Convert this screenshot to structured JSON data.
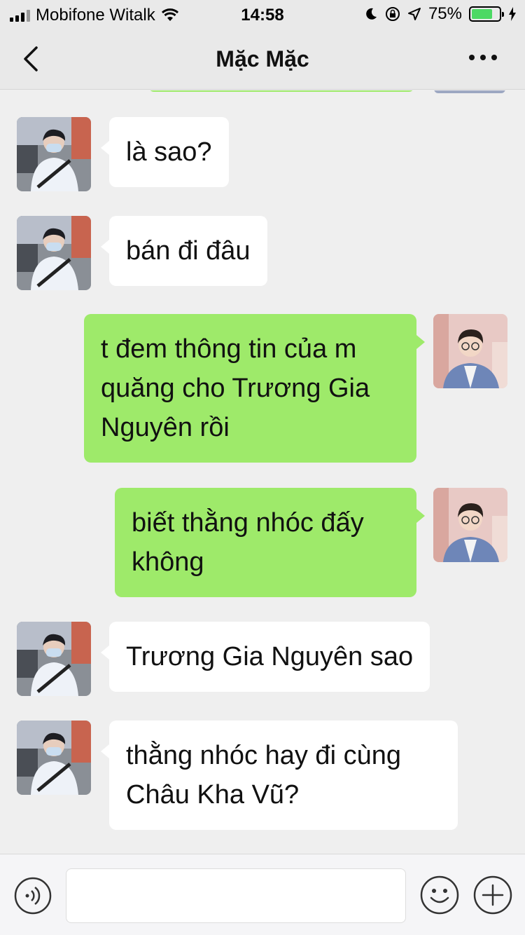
{
  "status_bar": {
    "carrier": "Mobifone Witalk",
    "time": "14:58",
    "battery_percent": "75%",
    "battery_level": 0.75,
    "signal_bars": 3,
    "icons": [
      "wifi-icon",
      "moon-icon",
      "orientation-lock-icon",
      "location-icon",
      "charging-icon"
    ]
  },
  "nav": {
    "title": "Mặc Mặc",
    "back_icon": "chevron-left-icon",
    "more_icon": "more-dots-icon"
  },
  "messages": [
    {
      "direction": "in",
      "lines": [
        "là sao?"
      ],
      "avatar": "avatar-contact"
    },
    {
      "direction": "in",
      "lines": [
        "bán đi đâu"
      ],
      "avatar": "avatar-contact"
    },
    {
      "direction": "out",
      "lines": [
        "t đem thông tin của m",
        "quăng cho Trương Gia",
        "Nguyên rồi"
      ],
      "avatar": "avatar-self"
    },
    {
      "direction": "out",
      "lines": [
        "biết thằng nhóc đấy",
        "không"
      ],
      "avatar": "avatar-self"
    },
    {
      "direction": "in",
      "lines": [
        "Trương Gia Nguyên sao"
      ],
      "avatar": "avatar-contact"
    },
    {
      "direction": "in",
      "lines": [
        "thằng nhóc hay đi cùng",
        "Châu Kha Vũ?"
      ],
      "avatar": "avatar-contact"
    }
  ],
  "input_bar": {
    "voice_icon": "voice-icon",
    "emoji_icon": "emoji-icon",
    "plus_icon": "plus-icon",
    "text_value": ""
  },
  "colors": {
    "outgoing_bubble": "#9eea6a",
    "incoming_bubble": "#ffffff",
    "chat_background": "#efefef",
    "battery_fill": "#4cd964"
  }
}
